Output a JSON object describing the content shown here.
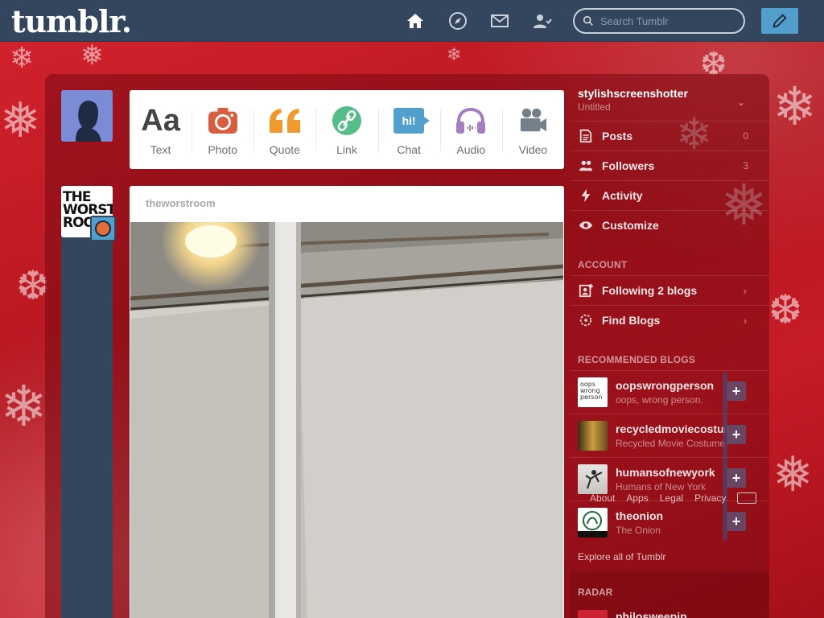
{
  "app": {
    "logo": "tumblr.",
    "accent_color": "#34465d",
    "compose_color": "#529ecc"
  },
  "nav": {
    "icons": [
      "home-icon",
      "explore-compass-icon",
      "messages-envelope-icon",
      "account-person-icon"
    ],
    "search_placeholder": "Search Tumblr"
  },
  "post_types": [
    {
      "label": "Text",
      "icon": "text-aa-icon",
      "color": "#444444",
      "glyph": "Aa"
    },
    {
      "label": "Photo",
      "icon": "camera-icon",
      "color": "#d95e40"
    },
    {
      "label": "Quote",
      "icon": "quote-icon",
      "color": "#f2992e"
    },
    {
      "label": "Link",
      "icon": "link-icon",
      "color": "#56bc8a"
    },
    {
      "label": "Chat",
      "icon": "chat-icon",
      "color": "#529ecc",
      "glyph": "hi!"
    },
    {
      "label": "Audio",
      "icon": "headphones-icon",
      "color": "#a77dc2"
    },
    {
      "label": "Video",
      "icon": "video-camera-icon",
      "color": "#748089"
    }
  ],
  "post": {
    "blog_name": "theworstroom",
    "avatar_text": "THE WORST ROO"
  },
  "sidebar": {
    "blog_name": "stylishscreenshotter",
    "blog_title": "Untitled",
    "items": [
      {
        "label": "Posts",
        "count": "0",
        "icon": "posts-icon"
      },
      {
        "label": "Followers",
        "count": "3",
        "icon": "followers-icon"
      },
      {
        "label": "Activity",
        "count": "",
        "icon": "activity-bolt-icon"
      },
      {
        "label": "Customize",
        "count": "",
        "icon": "customize-eye-icon"
      }
    ],
    "account_heading": "ACCOUNT",
    "account_items": [
      {
        "label": "Following 2 blogs",
        "icon": "following-icon"
      },
      {
        "label": "Find Blogs",
        "icon": "find-blogs-icon"
      }
    ],
    "recommended_heading": "RECOMMENDED BLOGS",
    "recommended": [
      {
        "name": "oopswrongperson",
        "subtitle": "oops, wrong person.",
        "avatar_color": "#ffffff"
      },
      {
        "name": "recycledmoviecostumes",
        "subtitle": "Recycled Movie Costumes",
        "avatar_color": "#a88230"
      },
      {
        "name": "humansofnewyork",
        "subtitle": "Humans of New York",
        "avatar_color": "#d8d4d2"
      },
      {
        "name": "theonion",
        "subtitle": "The Onion",
        "avatar_color": "#ffffff"
      }
    ],
    "footer_links": [
      "About",
      "Apps",
      "Legal",
      "Privacy"
    ],
    "explore_link": "Explore all of Tumblr",
    "radar_heading": "RADAR",
    "radar_blog": "philosweepin"
  }
}
